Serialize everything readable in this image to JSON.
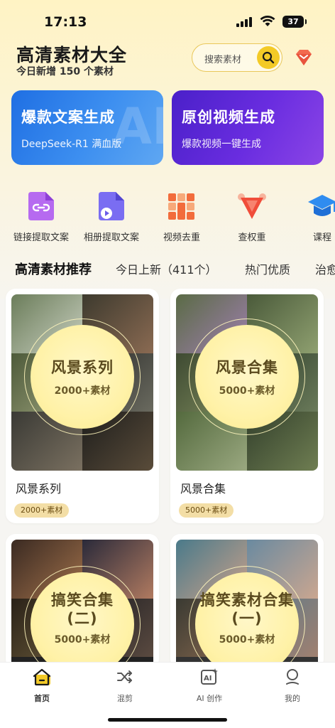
{
  "status": {
    "time": "17:13",
    "battery": "37"
  },
  "header": {
    "title": "高清素材大全",
    "subtitle": "今日新增 150 个素材",
    "search_placeholder": "搜索素材"
  },
  "banners": [
    {
      "title": "爆款文案生成",
      "subtitle": "DeepSeek-R1 满血版",
      "color": "#2a78e8"
    },
    {
      "title": "原创视频生成",
      "subtitle": "爆款视频一键生成",
      "color": "#5a27d8"
    }
  ],
  "tools": [
    {
      "label": "链接提取文案",
      "icon": "link-icon"
    },
    {
      "label": "相册提取文案",
      "icon": "video-file-icon"
    },
    {
      "label": "视频去重",
      "icon": "grid-icon"
    },
    {
      "label": "查权重",
      "icon": "triangle-icon"
    },
    {
      "label": "课程",
      "icon": "graduation-cap-icon"
    }
  ],
  "tabs": [
    "高清素材推荐",
    "今日上新（411个）",
    "热门优质",
    "治愈"
  ],
  "cards": [
    {
      "circle_title": "风景系列",
      "circle_count": "2000+素材",
      "name": "风景系列",
      "badge": "2000+素材"
    },
    {
      "circle_title": "风景合集",
      "circle_count": "5000+素材",
      "name": "风景合集",
      "badge": "5000+素材"
    },
    {
      "circle_title_1": "搞笑合集",
      "circle_title_2": "(二)",
      "circle_count": "5000+素材"
    },
    {
      "circle_title_1": "搞笑素材合集",
      "circle_title_2": "(一)",
      "circle_count": "5000+素材"
    }
  ],
  "nav": [
    {
      "label": "首页",
      "icon": "home-icon",
      "active": true
    },
    {
      "label": "混剪",
      "icon": "shuffle-icon",
      "active": false
    },
    {
      "label": "AI 创作",
      "icon": "ai-sparkle-icon",
      "active": false
    },
    {
      "label": "我的",
      "icon": "profile-icon",
      "active": false
    }
  ],
  "colors": {
    "accent": "#f3ca27",
    "badge_bg": "#f3dea6"
  }
}
